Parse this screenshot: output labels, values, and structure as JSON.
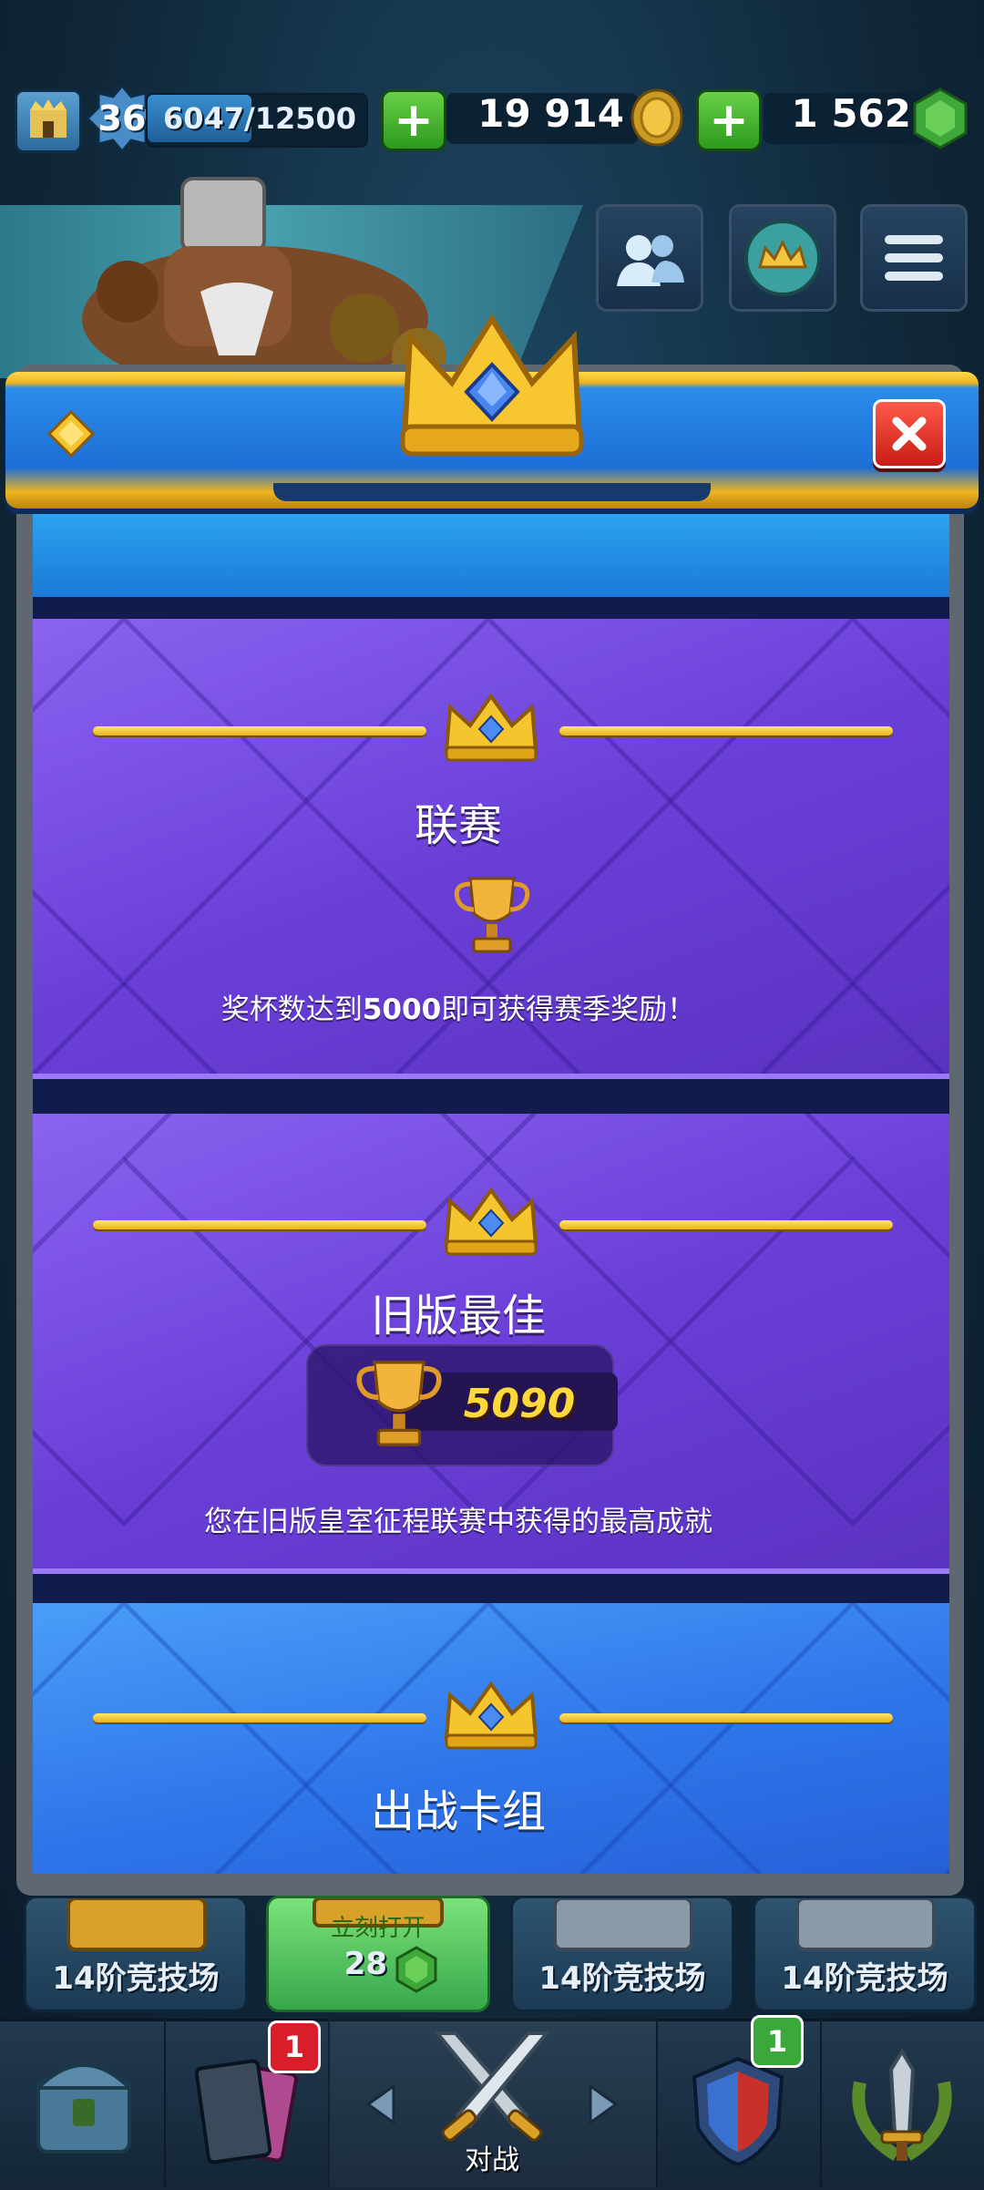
{
  "top_bar": {
    "level": "36",
    "xp_text": "6047/12500",
    "xp_fraction": 0.4838,
    "gold": "19 914",
    "gems": "1 562"
  },
  "modal": {
    "sections": [
      {
        "title": "联赛",
        "description_prefix": "奖杯数达到",
        "description_highlight": "5000",
        "description_suffix": "即可获得赛季奖励！"
      },
      {
        "title": "旧版最佳",
        "trophy_value": "5090",
        "description": "您在旧版皇室征程联赛中获得的最高成就"
      },
      {
        "title": "出战卡组"
      }
    ]
  },
  "chests": [
    {
      "label": "14阶竞技场"
    },
    {
      "label": "立刻打开",
      "gem_cost": "28"
    },
    {
      "label": "14阶竞技场"
    },
    {
      "label": "14阶竞技场"
    }
  ],
  "bottom_nav": {
    "cards_badge": "1",
    "clan_badge": "1",
    "battle_label": "对战"
  },
  "colors": {
    "gold": "#f0b420",
    "purple_panel": "#6a3fd8",
    "blue_panel": "#2f76ea",
    "plus_green": "#2d9a1e",
    "close_red": "#c81d14"
  }
}
